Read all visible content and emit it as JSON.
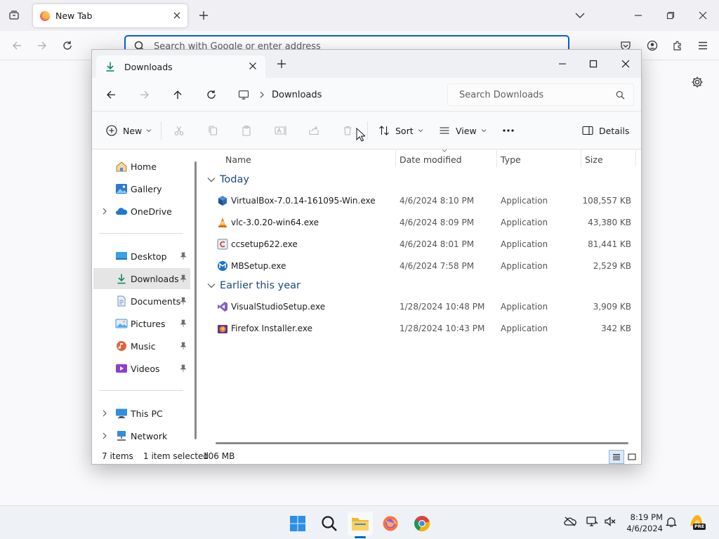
{
  "browser": {
    "tab_title": "New Tab",
    "address_placeholder": "Search with Google or enter address"
  },
  "explorer": {
    "tab_title": "Downloads",
    "breadcrumb": [
      "Downloads"
    ],
    "search_placeholder": "Search Downloads",
    "toolbar": {
      "new_label": "New",
      "sort_label": "Sort",
      "view_label": "View",
      "details_label": "Details"
    },
    "nav": {
      "home": "Home",
      "gallery": "Gallery",
      "onedrive": "OneDrive",
      "desktop": "Desktop",
      "downloads": "Downloads",
      "documents": "Documents",
      "pictures": "Pictures",
      "music": "Music",
      "videos": "Videos",
      "this_pc": "This PC",
      "network": "Network"
    },
    "columns": {
      "name": "Name",
      "date": "Date modified",
      "type": "Type",
      "size": "Size"
    },
    "groups": [
      {
        "title": "Today",
        "files": [
          {
            "name": "VirtualBox-7.0.14-161095-Win.exe",
            "date": "4/6/2024 8:10 PM",
            "type": "Application",
            "size": "108,557 KB",
            "icon": "virtualbox-icon"
          },
          {
            "name": "vlc-3.0.20-win64.exe",
            "date": "4/6/2024 8:09 PM",
            "type": "Application",
            "size": "43,380 KB",
            "icon": "vlc-icon"
          },
          {
            "name": "ccsetup622.exe",
            "date": "4/6/2024 8:01 PM",
            "type": "Application",
            "size": "81,441 KB",
            "icon": "ccleaner-icon"
          },
          {
            "name": "MBSetup.exe",
            "date": "4/6/2024 7:58 PM",
            "type": "Application",
            "size": "2,529 KB",
            "icon": "malwarebytes-icon"
          }
        ]
      },
      {
        "title": "Earlier this year",
        "files": [
          {
            "name": "VisualStudioSetup.exe",
            "date": "1/28/2024 10:48 PM",
            "type": "Application",
            "size": "3,909 KB",
            "icon": "visual-studio-icon"
          },
          {
            "name": "Firefox Installer.exe",
            "date": "1/28/2024 10:43 PM",
            "type": "Application",
            "size": "342 KB",
            "icon": "firefox-installer-icon"
          }
        ]
      }
    ],
    "status": {
      "items": "7 items",
      "selected": "1 item selected",
      "size": "106 MB"
    }
  },
  "taskbar": {
    "time": "8:19 PM",
    "date": "4/6/2024",
    "badge": "PRE"
  }
}
